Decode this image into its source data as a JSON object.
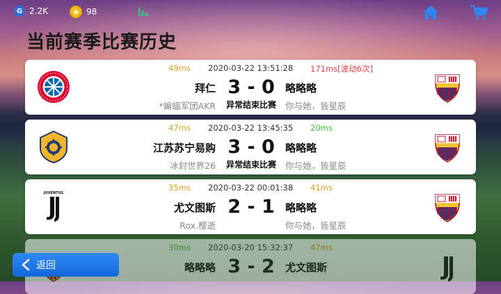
{
  "topbar": {
    "g_points": "2.2K",
    "coins": "98",
    "g_icon": "G",
    "coin_icon": "★"
  },
  "page": {
    "title": "当前赛季比赛历史"
  },
  "colors": {
    "ping_good": "#e0a020",
    "ping_great": "#3cbf3c",
    "ping_bad": "#e04040",
    "accent": "#1e7ce8"
  },
  "matches": [
    {
      "ping_left": "49ms",
      "ping_left_color": "#e0a020",
      "time": "2020-03-22 13:51:28",
      "ping_right": "171ms[波动6次]",
      "ping_right_color": "#e04040",
      "team_left": "拜仁",
      "score": "3 - 0",
      "team_right": "略略略",
      "player_left": "*蝙蝠军团AKR",
      "status": "异常结束比赛",
      "player_right": "你与她，皆星辰",
      "logo_left": "bayern-logo",
      "logo_right": "barcelona-logo"
    },
    {
      "ping_left": "47ms",
      "ping_left_color": "#e0a020",
      "time": "2020-03-22 13:45:35",
      "ping_right": "20ms",
      "ping_right_color": "#3cbf3c",
      "team_left": "江苏苏宁易购",
      "score": "3 - 0",
      "team_right": "略略略",
      "player_left": "冰封世界26",
      "status": "异常结束比赛",
      "player_right": "你与她，皆星辰",
      "logo_left": "suning-logo",
      "logo_right": "barcelona-logo"
    },
    {
      "ping_left": "35ms",
      "ping_left_color": "#e0a020",
      "time": "2020-03-22 00:01:38",
      "ping_right": "41ms",
      "ping_right_color": "#e0a020",
      "team_left": "尤文图斯",
      "score": "2 - 1",
      "team_right": "略略略",
      "player_left": "Rox.樱逝",
      "status": "",
      "player_right": "你与她，皆星辰",
      "logo_left": "juventus-logo",
      "logo_right": "barcelona-logo"
    },
    {
      "ping_left": "30ms",
      "ping_left_color": "#3cbf3c",
      "time": "2020-03-20 15:32:37",
      "ping_right": "47ms",
      "ping_right_color": "#e0a020",
      "team_left": "略略略",
      "score": "3 - 2",
      "team_right": "尤文图斯",
      "player_left": "",
      "status": "",
      "player_right": "",
      "logo_left": "barcelona-logo",
      "logo_right": "juventus-logo"
    }
  ],
  "footer": {
    "back_label": "返回",
    "back_icon": "chevron-left-icon"
  }
}
